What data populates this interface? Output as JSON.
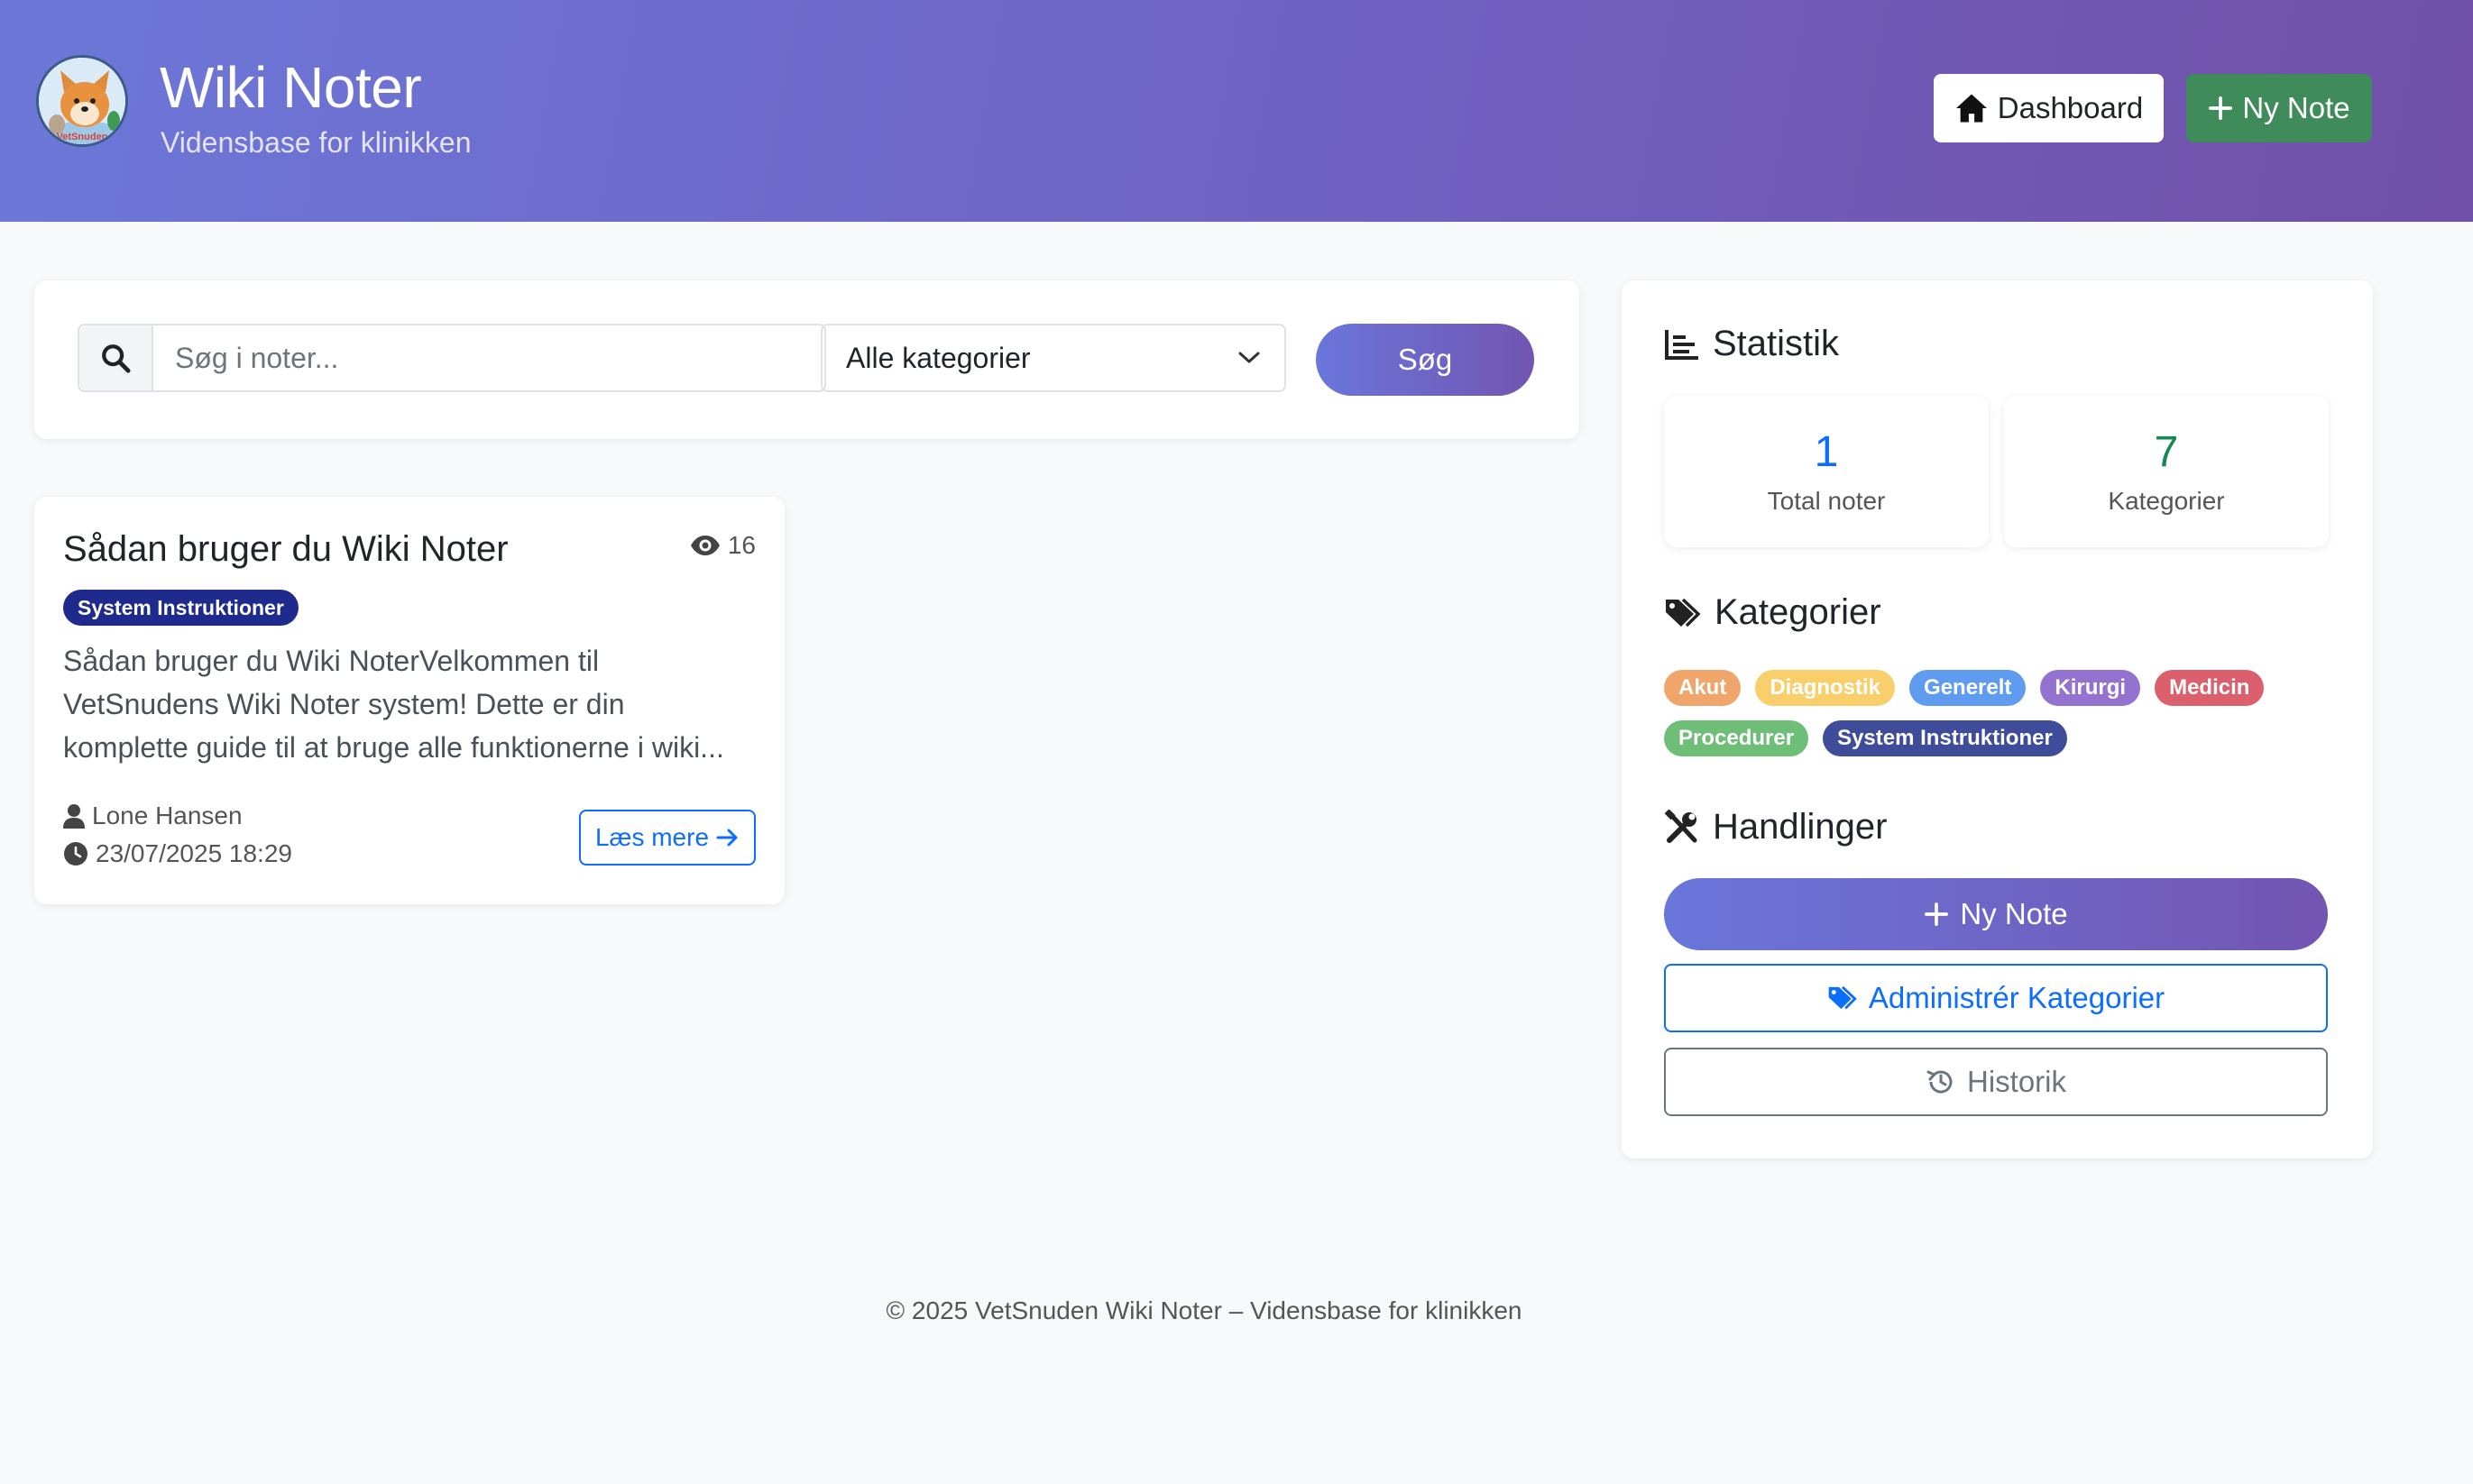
{
  "header": {
    "title": "Wiki Noter",
    "subtitle": "Vidensbase for klinikken",
    "logo_text": "VetSnuden",
    "dashboard_label": "Dashboard",
    "new_note_label": "Ny Note"
  },
  "search": {
    "placeholder": "Søg i noter...",
    "category_selected": "Alle kategorier",
    "button_label": "Søg"
  },
  "notes": [
    {
      "title": "Sådan bruger du Wiki Noter",
      "views": "16",
      "category": "System Instruktioner",
      "excerpt_lines": [
        "Sådan bruger du Wiki NoterVelkommen til",
        "VetSnudens Wiki Noter system! Dette er din",
        "komplette guide til at bruge alle funktionerne i wiki..."
      ],
      "author": "Lone Hansen",
      "date": "23/07/2025 18:29",
      "read_more": "Læs mere"
    }
  ],
  "sidebar": {
    "stats_heading": "Statistik",
    "stats": [
      {
        "value": "1",
        "label": "Total noter",
        "color": "#0d6efd"
      },
      {
        "value": "7",
        "label": "Kategorier",
        "color": "#198754"
      }
    ],
    "categories_heading": "Kategorier",
    "categories": [
      {
        "label": "Akut",
        "color": "#f0a56b"
      },
      {
        "label": "Diagnostik",
        "color": "#f8cf6b"
      },
      {
        "label": "Generelt",
        "color": "#5f9cf0"
      },
      {
        "label": "Kirurgi",
        "color": "#9473d0"
      },
      {
        "label": "Medicin",
        "color": "#db5f6d"
      },
      {
        "label": "Procedurer",
        "color": "#6fbe78"
      },
      {
        "label": "System Instruktioner",
        "color": "#3f4c9a"
      }
    ],
    "actions_heading": "Handlinger",
    "actions": {
      "new_note": "Ny Note",
      "manage_categories": "Administrér Kategorier",
      "history": "Historik"
    }
  },
  "footer": {
    "text": "© 2025 VetSnuden Wiki Noter – Vidensbase for klinikken"
  }
}
